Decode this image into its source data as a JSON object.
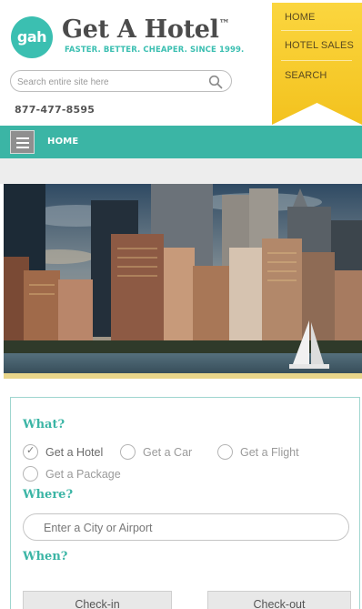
{
  "brand": {
    "logo_text": "gah",
    "name": "Get A Hotel",
    "trademark": "™",
    "tagline": "FASTER. BETTER. CHEAPER. SINCE 1999."
  },
  "search": {
    "placeholder": "Search entire site here",
    "value": ""
  },
  "phone": "877-477-8595",
  "ribbon_menu": {
    "items": [
      {
        "label": "HOME"
      },
      {
        "label": "HOTEL SALES"
      },
      {
        "label": "SEARCH"
      }
    ]
  },
  "nav": {
    "home_label": "HOME"
  },
  "booking": {
    "what_label": "What?",
    "options": [
      {
        "label": "Get a Hotel",
        "checked": true
      },
      {
        "label": "Get a Car",
        "checked": false
      },
      {
        "label": "Get a Flight",
        "checked": false
      },
      {
        "label": "Get a Package",
        "checked": false
      }
    ],
    "where_label": "Where?",
    "where_placeholder": "Enter a City or Airport",
    "when_label": "When?",
    "checkin_label": "Check-in",
    "checkout_label": "Check-out"
  },
  "colors": {
    "teal": "#3bb5a5",
    "ribbon_yellow": "#f9d03a",
    "text_gray": "#555555"
  }
}
